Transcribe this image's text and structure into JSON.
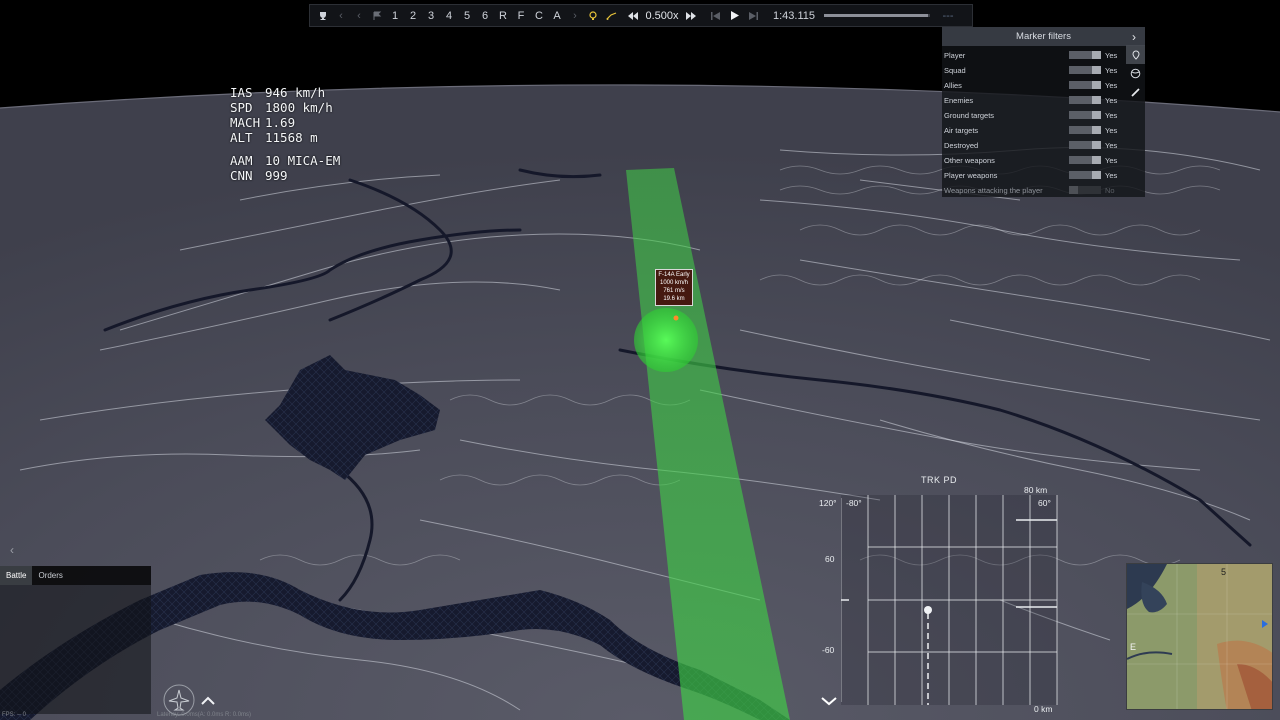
{
  "toolbar": {
    "camera_numbers": [
      "1",
      "2",
      "3",
      "4",
      "5",
      "6"
    ],
    "camera_letters": [
      "R",
      "F",
      "C",
      "A"
    ],
    "speed": "0.500x",
    "time": "1:43.115",
    "dashes": "---",
    "progress_fraction": 0.98,
    "icons": [
      "trophy-icon",
      "chevron-left-icon",
      "chevron-left-icon",
      "flag-icon",
      "chevron-right-icon",
      "bulb-icon",
      "path-icon",
      "rewind-icon",
      "fast-forward-icon",
      "step-back-icon",
      "play-icon",
      "step-forward-icon"
    ]
  },
  "hud": {
    "ias_label": "IAS",
    "ias_value": "946 km/h",
    "spd_label": "SPD",
    "spd_value": "1800 km/h",
    "mach_label": "MACH",
    "mach_value": "1.69",
    "alt_label": "ALT",
    "alt_value": "11568 m",
    "aam_label": "AAM",
    "aam_value": "10 MICA-EM",
    "cnn_label": "CNN",
    "cnn_value": "999"
  },
  "marker_filters": {
    "title": "Marker filters",
    "rows": [
      {
        "label": "Player",
        "value": "Yes",
        "on": true
      },
      {
        "label": "Squad",
        "value": "Yes",
        "on": true
      },
      {
        "label": "Allies",
        "value": "Yes",
        "on": true
      },
      {
        "label": "Enemies",
        "value": "Yes",
        "on": true
      },
      {
        "label": "Ground targets",
        "value": "Yes",
        "on": true
      },
      {
        "label": "Air targets",
        "value": "Yes",
        "on": true
      },
      {
        "label": "Destroyed",
        "value": "Yes",
        "on": true
      },
      {
        "label": "Other weapons",
        "value": "Yes",
        "on": true
      },
      {
        "label": "Player weapons",
        "value": "Yes",
        "on": true
      },
      {
        "label": "Weapons attacking the player",
        "value": "No",
        "on": false
      }
    ]
  },
  "target": {
    "name": "F-14A Early",
    "speed": "1000 km/h",
    "closure": "761 m/s",
    "distance": "19.6 km"
  },
  "chat": {
    "tab_battle": "Battle",
    "tab_orders": "Orders"
  },
  "status": {
    "latency": "Latency: 0.0ms(A: 0.0ms R: 0.0ms)",
    "fps_left": "FPS: --    0"
  },
  "radar": {
    "mode": "TRK PD",
    "range": "80 km",
    "bottom_range": "0 km",
    "left_top": "120°",
    "az_left": "-80°",
    "az_right": "60°",
    "elev_top": "60",
    "elev_bottom": "-60"
  },
  "minimap": {
    "grid_number": "5",
    "grid_letter": "E"
  },
  "colors": {
    "beam": "#34c93a",
    "target_box": "#460808",
    "terrain": "#4b4c5a"
  }
}
